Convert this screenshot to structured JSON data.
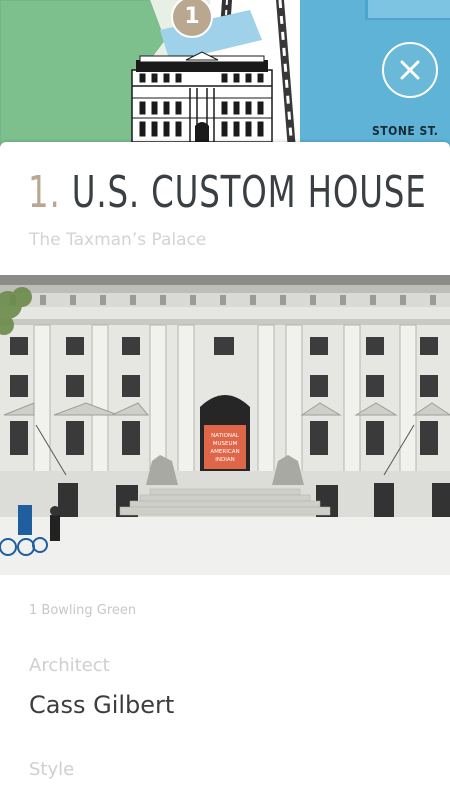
{
  "map": {
    "marker_number": "1",
    "street_label": "STONE ST.",
    "close_icon": "close-icon",
    "colors": {
      "water": "#5fb3d6",
      "park": "#7dc08e",
      "marker": "#b9a78f"
    }
  },
  "place": {
    "number": "1.",
    "name": "U.S. CUSTOM HOUSE",
    "subtitle": "The Taxman’s Palace",
    "photo_banner": "NATIONAL MUSEUM OF THE AMERICAN INDIAN",
    "address": "1 Bowling Green",
    "architect_label": "Architect",
    "architect_value": "Cass Gilbert",
    "style_label": "Style"
  }
}
